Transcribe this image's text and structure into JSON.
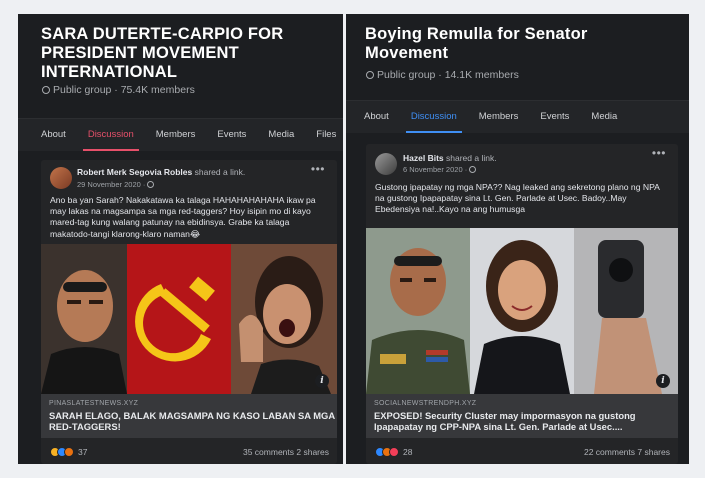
{
  "left": {
    "title": "SARA DUTERTE-CARPIO FOR PRESIDENT MOVEMENT INTERNATIONAL",
    "meta": "Public group · 75.4K members",
    "tabs": [
      "About",
      "Discussion",
      "Members",
      "Events",
      "Media",
      "Files"
    ],
    "active_tab": "Discussion",
    "accent": "#e6506a",
    "post": {
      "author": "Robert Merk Segovia Robles",
      "action": "shared a link.",
      "date": "29 November 2020 ·",
      "text": "Ano ba yan Sarah? Nakakatawa ka talaga HAHAHAHAHAHA ikaw pa may lakas na magsampa sa mga red-taggers? Hoy isipin mo di kayo mared-tag kung walang patunay na ebidinsya. Grabe ka talaga makatodo-tangi klarong-klaro naman😂",
      "link_domain": "PINASLATESTNEWS.XYZ",
      "link_headline": "SARAH ELAGO, BALAK MAGSAMPA NG KASO LABAN SA MGA RED-TAGGERS!",
      "reaction_count": "37",
      "comments": "35 comments",
      "shares": "2 shares"
    }
  },
  "right": {
    "title": "Boying Remulla for Senator Movement",
    "meta": "Public group · 14.1K members",
    "tabs": [
      "About",
      "Discussion",
      "Members",
      "Events",
      "Media"
    ],
    "active_tab": "Discussion",
    "accent": "#3f8ff4",
    "post": {
      "author": "Hazel Bits",
      "action": "shared a link.",
      "date": "6 November 2020 ·",
      "text": "Gustong ipapatay ng mga NPA?? Nag leaked ang sekretong plano ng NPA na gustong Ipapapatay sina Lt. Gen. Parlade at Usec. Badoy..May Ebedensiya na!..Kayo na ang humusga",
      "link_domain": "SOCIALNEWSTRENDPH.XYZ",
      "link_headline": "EXPOSED! Security Cluster may impormasyon na gustong Ipapapatay ng CPP-NPA sina Lt. Gen. Parlade at Usec....",
      "reaction_count": "28",
      "comments": "22 comments",
      "shares": "7 shares"
    }
  }
}
